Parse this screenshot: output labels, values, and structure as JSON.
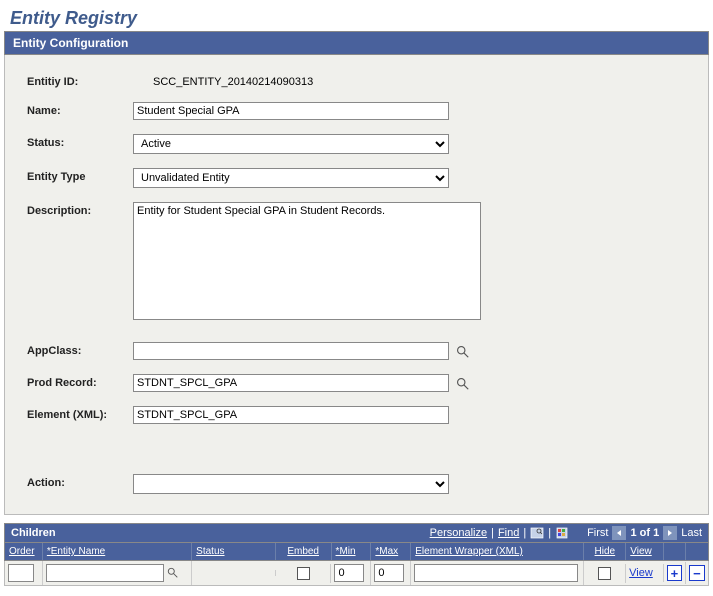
{
  "title": "Entity Registry",
  "section1": {
    "header": "Entity Configuration",
    "entity_id_label": "Entitiy ID:",
    "entity_id": "SCC_ENTITY_20140214090313",
    "name_label": "Name:",
    "name": "Student Special GPA",
    "status_label": "Status:",
    "status": "Active",
    "entity_type_label": "Entity Type",
    "entity_type": "Unvalidated Entity",
    "description_label": "Description:",
    "description": "Entity for Student Special GPA in Student Records.",
    "appclass_label": "AppClass:",
    "appclass": "",
    "prodrec_label": "Prod Record:",
    "prodrec": "STDNT_SPCL_GPA",
    "elemxml_label": "Element (XML):",
    "elemxml": "STDNT_SPCL_GPA",
    "action_label": "Action:",
    "action": ""
  },
  "children": {
    "header": "Children",
    "personalize": "Personalize",
    "find": "Find",
    "first": "First",
    "pager": "1 of 1",
    "last": "Last",
    "cols": {
      "order": "Order",
      "entity_name": "*Entity Name",
      "status": "Status",
      "embed": "Embed",
      "min": "*Min",
      "max": "*Max",
      "wrapper": "Element Wrapper (XML)",
      "hide": "Hide",
      "view": "View"
    },
    "row": {
      "order": "",
      "entity_name": "",
      "status": "",
      "embed_checked": false,
      "min": "0",
      "max": "0",
      "wrapper": "",
      "hide_checked": false,
      "view_label": "View"
    }
  }
}
